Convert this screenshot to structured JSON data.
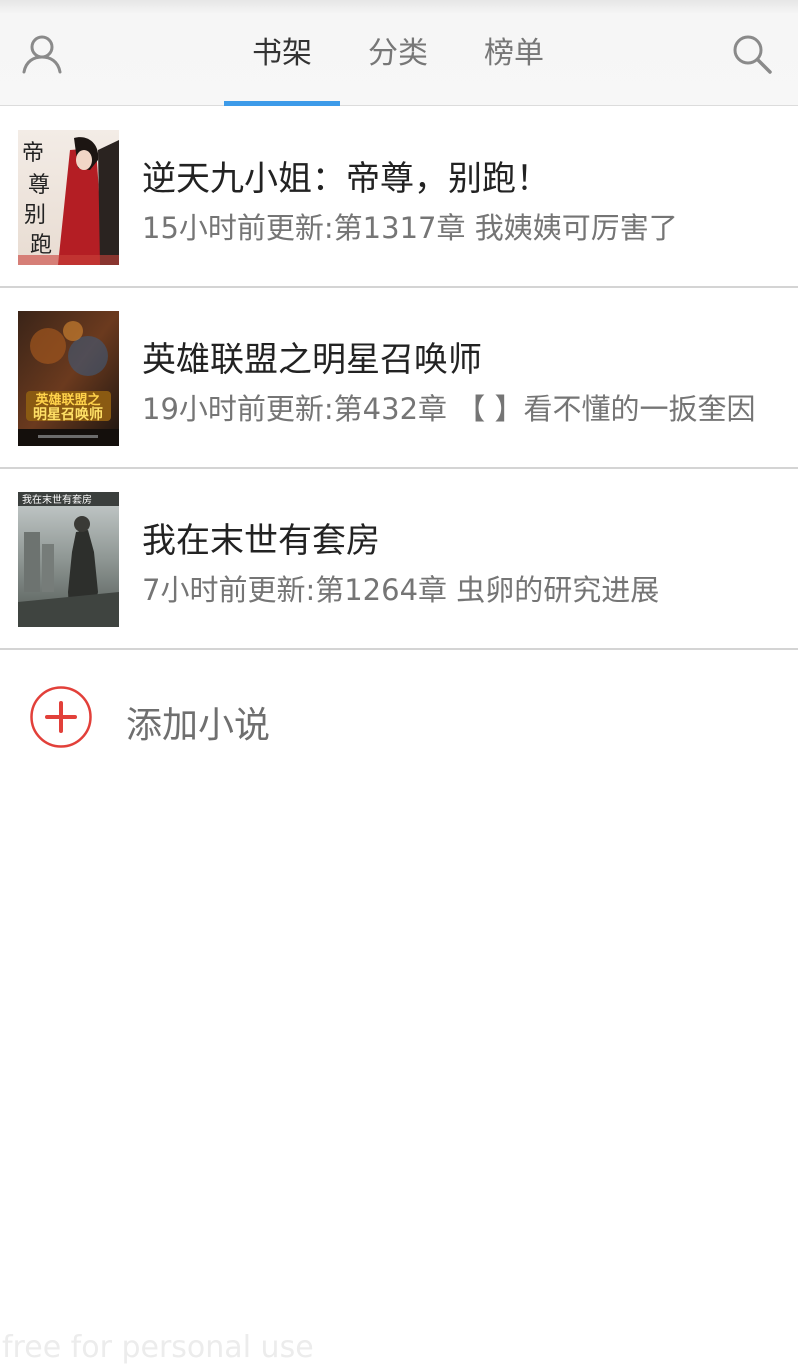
{
  "header": {
    "tabs": [
      {
        "label": "书架",
        "active": true
      },
      {
        "label": "分类",
        "active": false
      },
      {
        "label": "榜单",
        "active": false
      }
    ],
    "left_icon": "user-profile-icon",
    "right_icon": "search-icon",
    "accent_color": "#3d9be9"
  },
  "books": [
    {
      "title": "逆天九小姐：帝尊，别跑！",
      "update": "15小时前更新:第1317章 我姨姨可厉害了"
    },
    {
      "title": "英雄联盟之明星召唤师",
      "update": "19小时前更新:第432章 【 】看不懂的一扳奎因"
    },
    {
      "title": "我在末世有套房",
      "update": "7小时前更新:第1264章 虫卵的研究进展"
    }
  ],
  "add_novel": {
    "label": "添加小说",
    "icon": "add-circle-icon",
    "icon_color": "#e2403a"
  },
  "watermark": "free for personal use"
}
